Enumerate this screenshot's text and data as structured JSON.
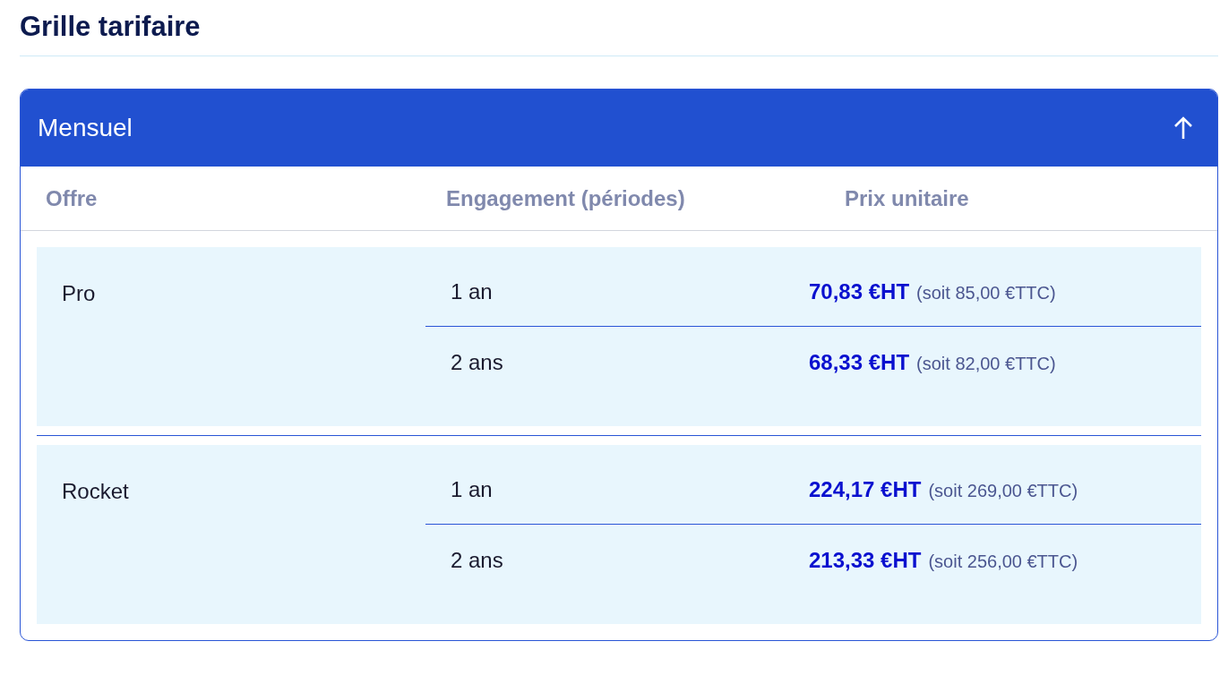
{
  "title": "Grille tarifaire",
  "panel": {
    "title": "Mensuel",
    "expanded": true,
    "columns": [
      "Offre",
      "Engagement (périodes)",
      "Prix unitaire"
    ],
    "offers": [
      {
        "name": "Pro",
        "rows": [
          {
            "engagement": "1 an",
            "price": "70,83 €HT",
            "price_ttc": "(soit 85,00 €TTC)"
          },
          {
            "engagement": "2 ans",
            "price": "68,33 €HT",
            "price_ttc": "(soit 82,00 €TTC)"
          }
        ]
      },
      {
        "name": "Rocket",
        "rows": [
          {
            "engagement": "1 an",
            "price": "224,17 €HT",
            "price_ttc": "(soit 269,00 €TTC)"
          },
          {
            "engagement": "2 ans",
            "price": "213,33 €HT",
            "price_ttc": "(soit 256,00 €TTC)"
          }
        ]
      }
    ]
  }
}
